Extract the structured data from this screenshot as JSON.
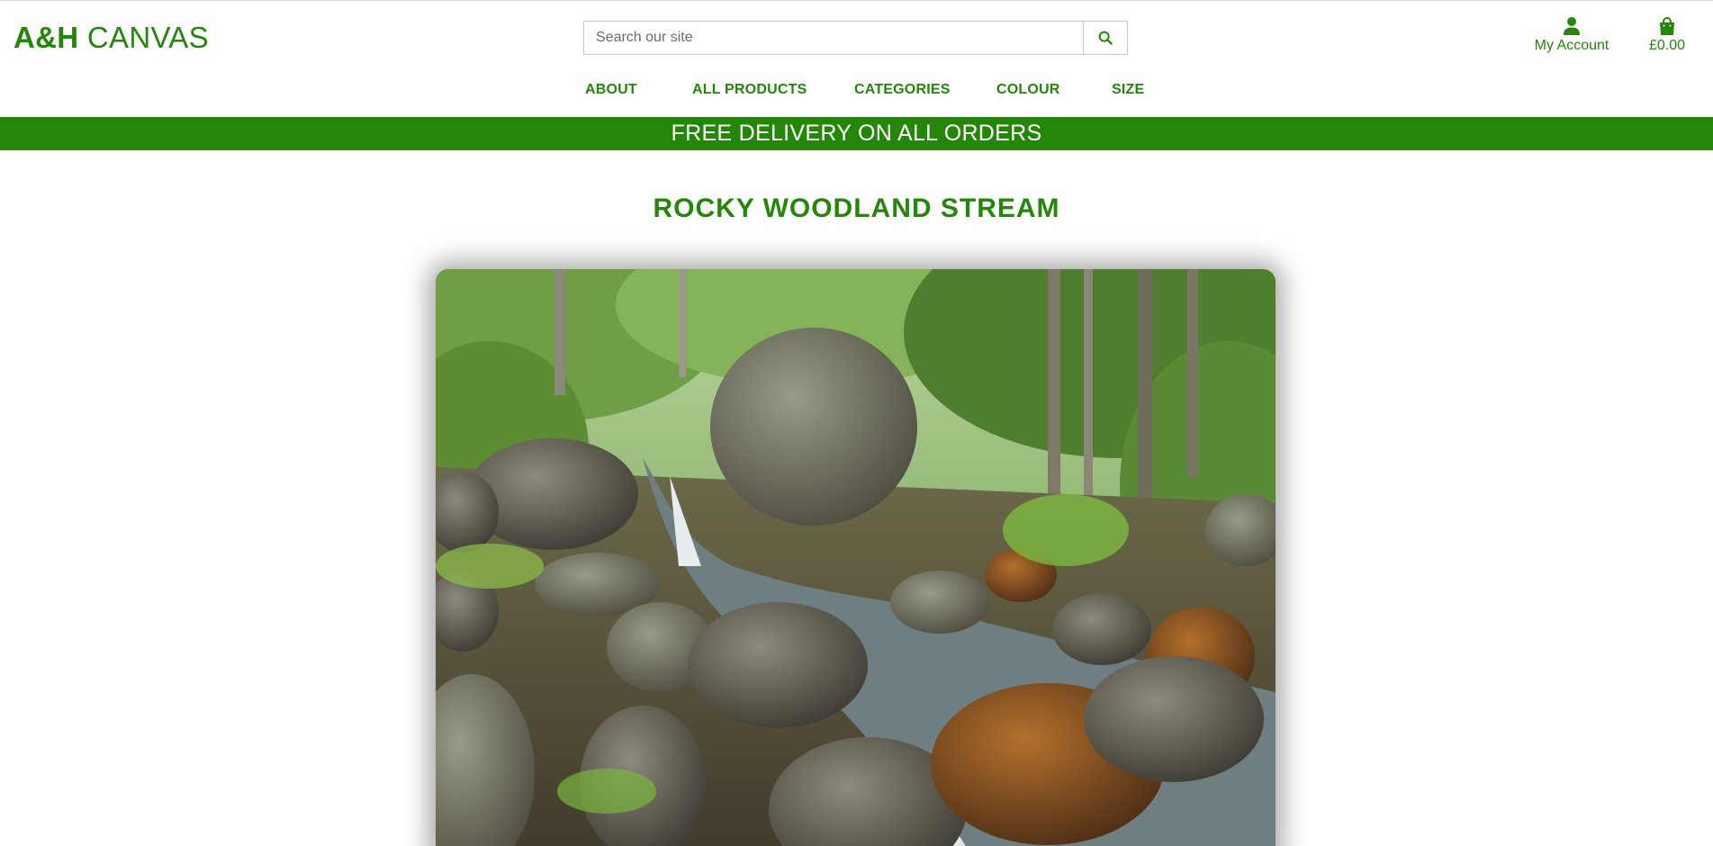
{
  "header": {
    "logo_strong": "A&H",
    "logo_light": "CANVAS",
    "search_placeholder": "Search our site",
    "search_icon": "magnifier-icon",
    "account_label": "My Account",
    "account_icon": "user-icon",
    "bag_total": "£0.00",
    "bag_icon": "shopping-bag-icon"
  },
  "nav": {
    "items": [
      "ABOUT",
      "ALL PRODUCTS",
      "CATEGORIES",
      "COLOUR",
      "SIZE"
    ]
  },
  "banner": {
    "text": "FREE DELIVERY ON ALL ORDERS"
  },
  "product": {
    "title": "ROCKY WOODLAND STREAM"
  },
  "colors": {
    "brand_green": "#24870a",
    "white": "#ffffff"
  }
}
